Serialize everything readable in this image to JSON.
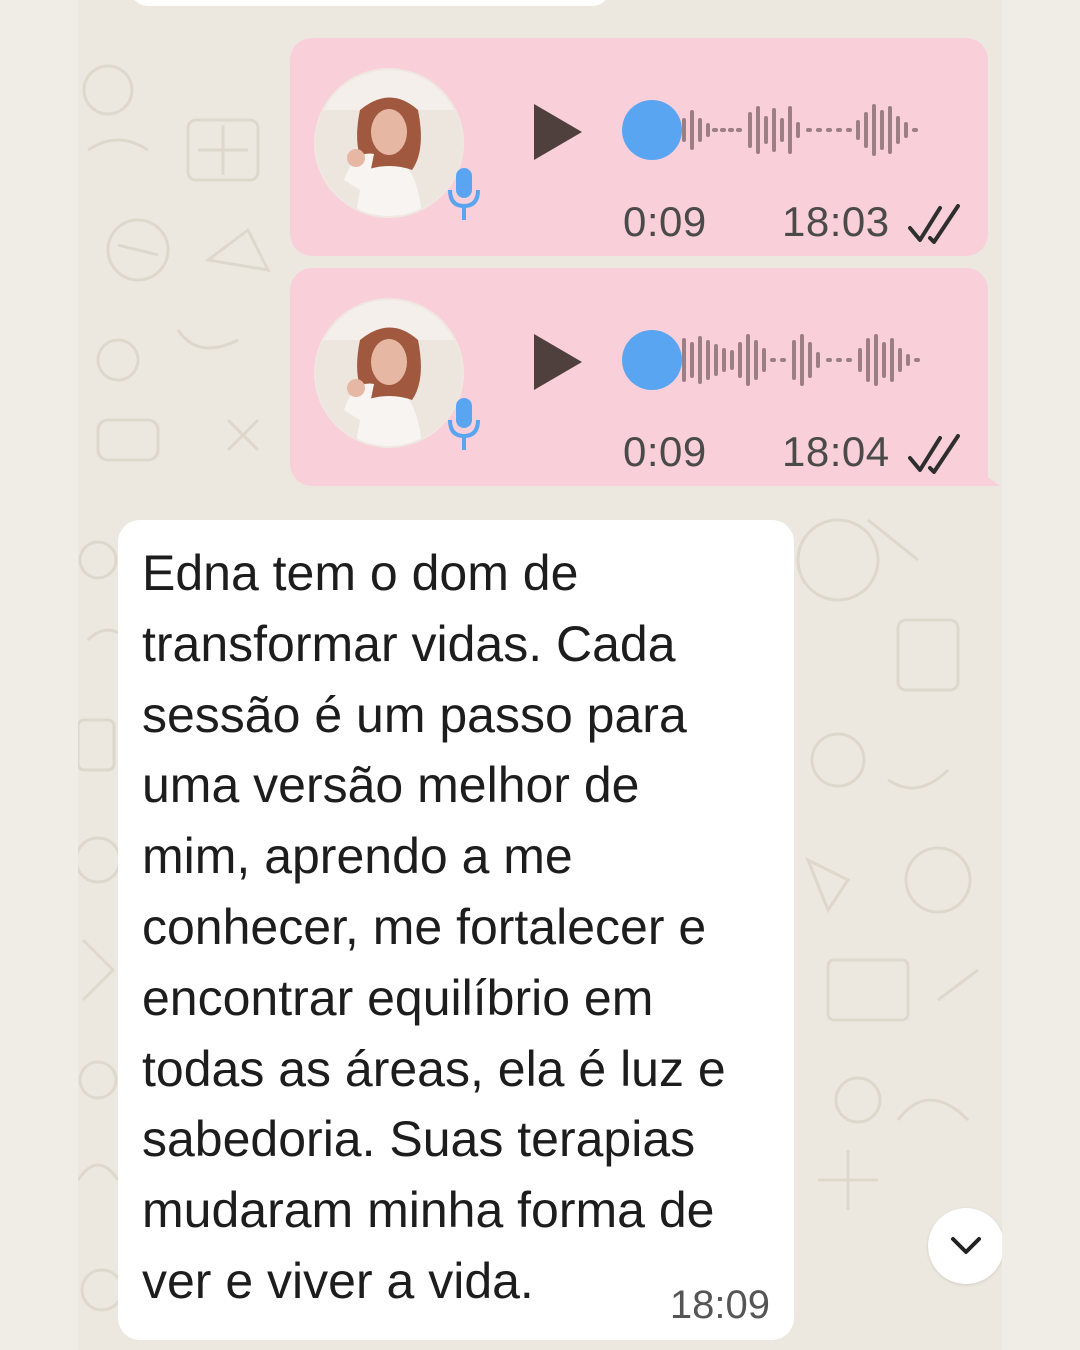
{
  "messages": {
    "voice_notes": [
      {
        "duration": "0:09",
        "time": "18:03",
        "status_icon": "double-check-icon",
        "progress": 0
      },
      {
        "duration": "0:09",
        "time": "18:04",
        "status_icon": "double-check-icon",
        "progress": 0
      }
    ],
    "text_message": {
      "text": "Edna tem o dom de\ntransformar vidas. Cada\nsessão é um passo para\numa versão melhor de\nmim, aprendo a me\nconhecer, me fortalecer e\nencontrar equilíbrio em\ntodas as áreas, ela é luz e\nsabedoria. Suas terapias\nmudaram minha forma de\nver e viver a vida.",
      "time": "18:09"
    }
  },
  "colors": {
    "outgoing_bubble": "#f9cfd9",
    "incoming_bubble": "#ffffff",
    "progress_dot": "#5aa5f1",
    "chat_background": "#ede8df"
  },
  "icons": [
    "play-icon",
    "microphone-icon",
    "double-check-icon",
    "chevron-down-icon"
  ]
}
